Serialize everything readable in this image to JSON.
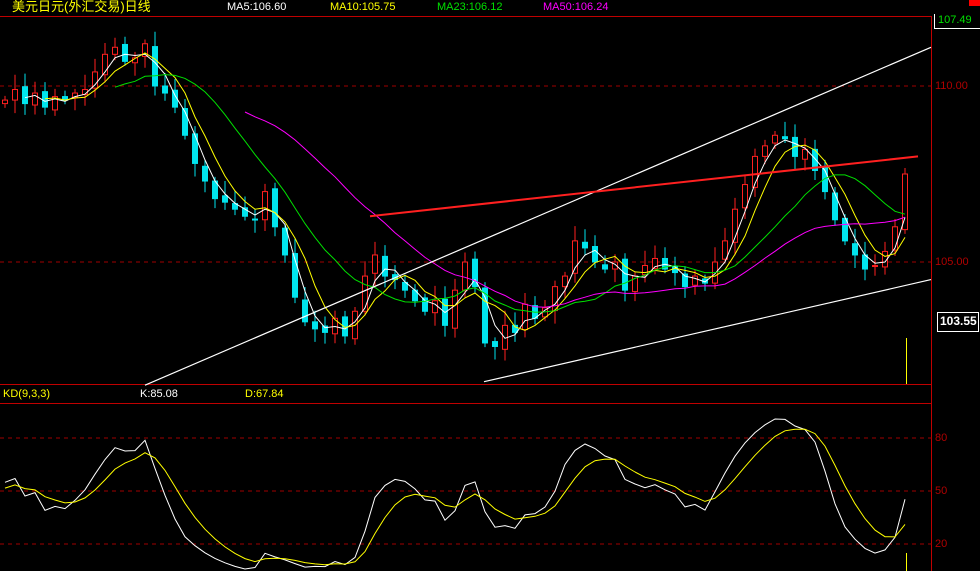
{
  "header": {
    "title": "美元日元(外汇交易)日线",
    "ma5": "MA5:106.60",
    "ma10": "MA10:105.75",
    "ma23": "MA23:106.12",
    "ma50": "MA50:106.24"
  },
  "price_labels": {
    "top": "107.49",
    "current": "103.55"
  },
  "kd_header": {
    "name": "KD(9,3,3)",
    "k": "K:85.08",
    "d": "D:67.84"
  },
  "colors": {
    "up": "#ff2020",
    "down": "#00e5ee",
    "grid": "#a00000",
    "ma5": "#ffffff",
    "ma10": "#ffff00",
    "ma23": "#00e000",
    "ma50": "#ff00ff",
    "trend_white": "#ffffff",
    "trend_red": "#ff2020"
  },
  "chart_data": [
    {
      "type": "candlestick",
      "title": "美元日元(外汇交易)日线",
      "ylim": [
        101.5,
        111.96
      ],
      "y_ticks": [
        "110.00",
        "105.00"
      ],
      "y_tick_values": [
        110,
        105
      ],
      "closes": [
        109.6,
        109.9,
        109.5,
        109.8,
        109.4,
        109.7,
        109.6,
        109.8,
        109.9,
        110.4,
        110.9,
        111.1,
        110.7,
        110.8,
        111.2,
        110.0,
        109.8,
        109.4,
        108.6,
        107.8,
        107.3,
        106.8,
        106.7,
        106.5,
        106.3,
        106.2,
        107.0,
        106.0,
        105.2,
        104.0,
        103.3,
        103.1,
        103.0,
        103.4,
        102.9,
        103.6,
        104.6,
        105.2,
        104.6,
        104.5,
        104.2,
        103.9,
        103.6,
        103.9,
        103.2,
        104.2,
        105.0,
        104.3,
        102.7,
        102.6,
        103.2,
        103.0,
        103.8,
        103.4,
        103.7,
        104.3,
        104.6,
        105.6,
        105.4,
        105.0,
        104.8,
        105.0,
        104.2,
        104.6,
        104.9,
        105.1,
        104.8,
        104.7,
        104.3,
        104.6,
        104.4,
        105.0,
        105.6,
        106.5,
        107.2,
        108.0,
        108.3,
        108.6,
        108.5,
        108.0,
        108.2,
        107.6,
        107.0,
        106.2,
        105.6,
        105.2,
        104.8,
        104.9,
        105.3,
        106.0,
        107.5
      ],
      "moving_averages": [
        {
          "name": "MA5",
          "period": 5
        },
        {
          "name": "MA10",
          "period": 10
        },
        {
          "name": "MA23",
          "period": 23
        },
        {
          "name": "MA50",
          "period": 50
        }
      ],
      "trendlines": [
        {
          "name": "upper-channel",
          "color": "white",
          "from": [
            14,
            101.5
          ],
          "to": [
            92.6,
            111.1
          ]
        },
        {
          "name": "lower-channel",
          "color": "white",
          "from": [
            47.9,
            101.6
          ],
          "to": [
            92.6,
            104.5
          ]
        },
        {
          "name": "resistance",
          "color": "red",
          "from": [
            36.5,
            106.3
          ],
          "to": [
            91.3,
            108.0
          ]
        }
      ]
    },
    {
      "type": "line",
      "title": "KD(9,3,3)",
      "ylim": [
        0,
        100
      ],
      "y_ticks": [
        "80",
        "50",
        "20"
      ],
      "y_tick_values": [
        80,
        50,
        20
      ],
      "series": [
        {
          "name": "K",
          "last": 85.08
        },
        {
          "name": "D",
          "last": 67.84
        }
      ]
    }
  ]
}
